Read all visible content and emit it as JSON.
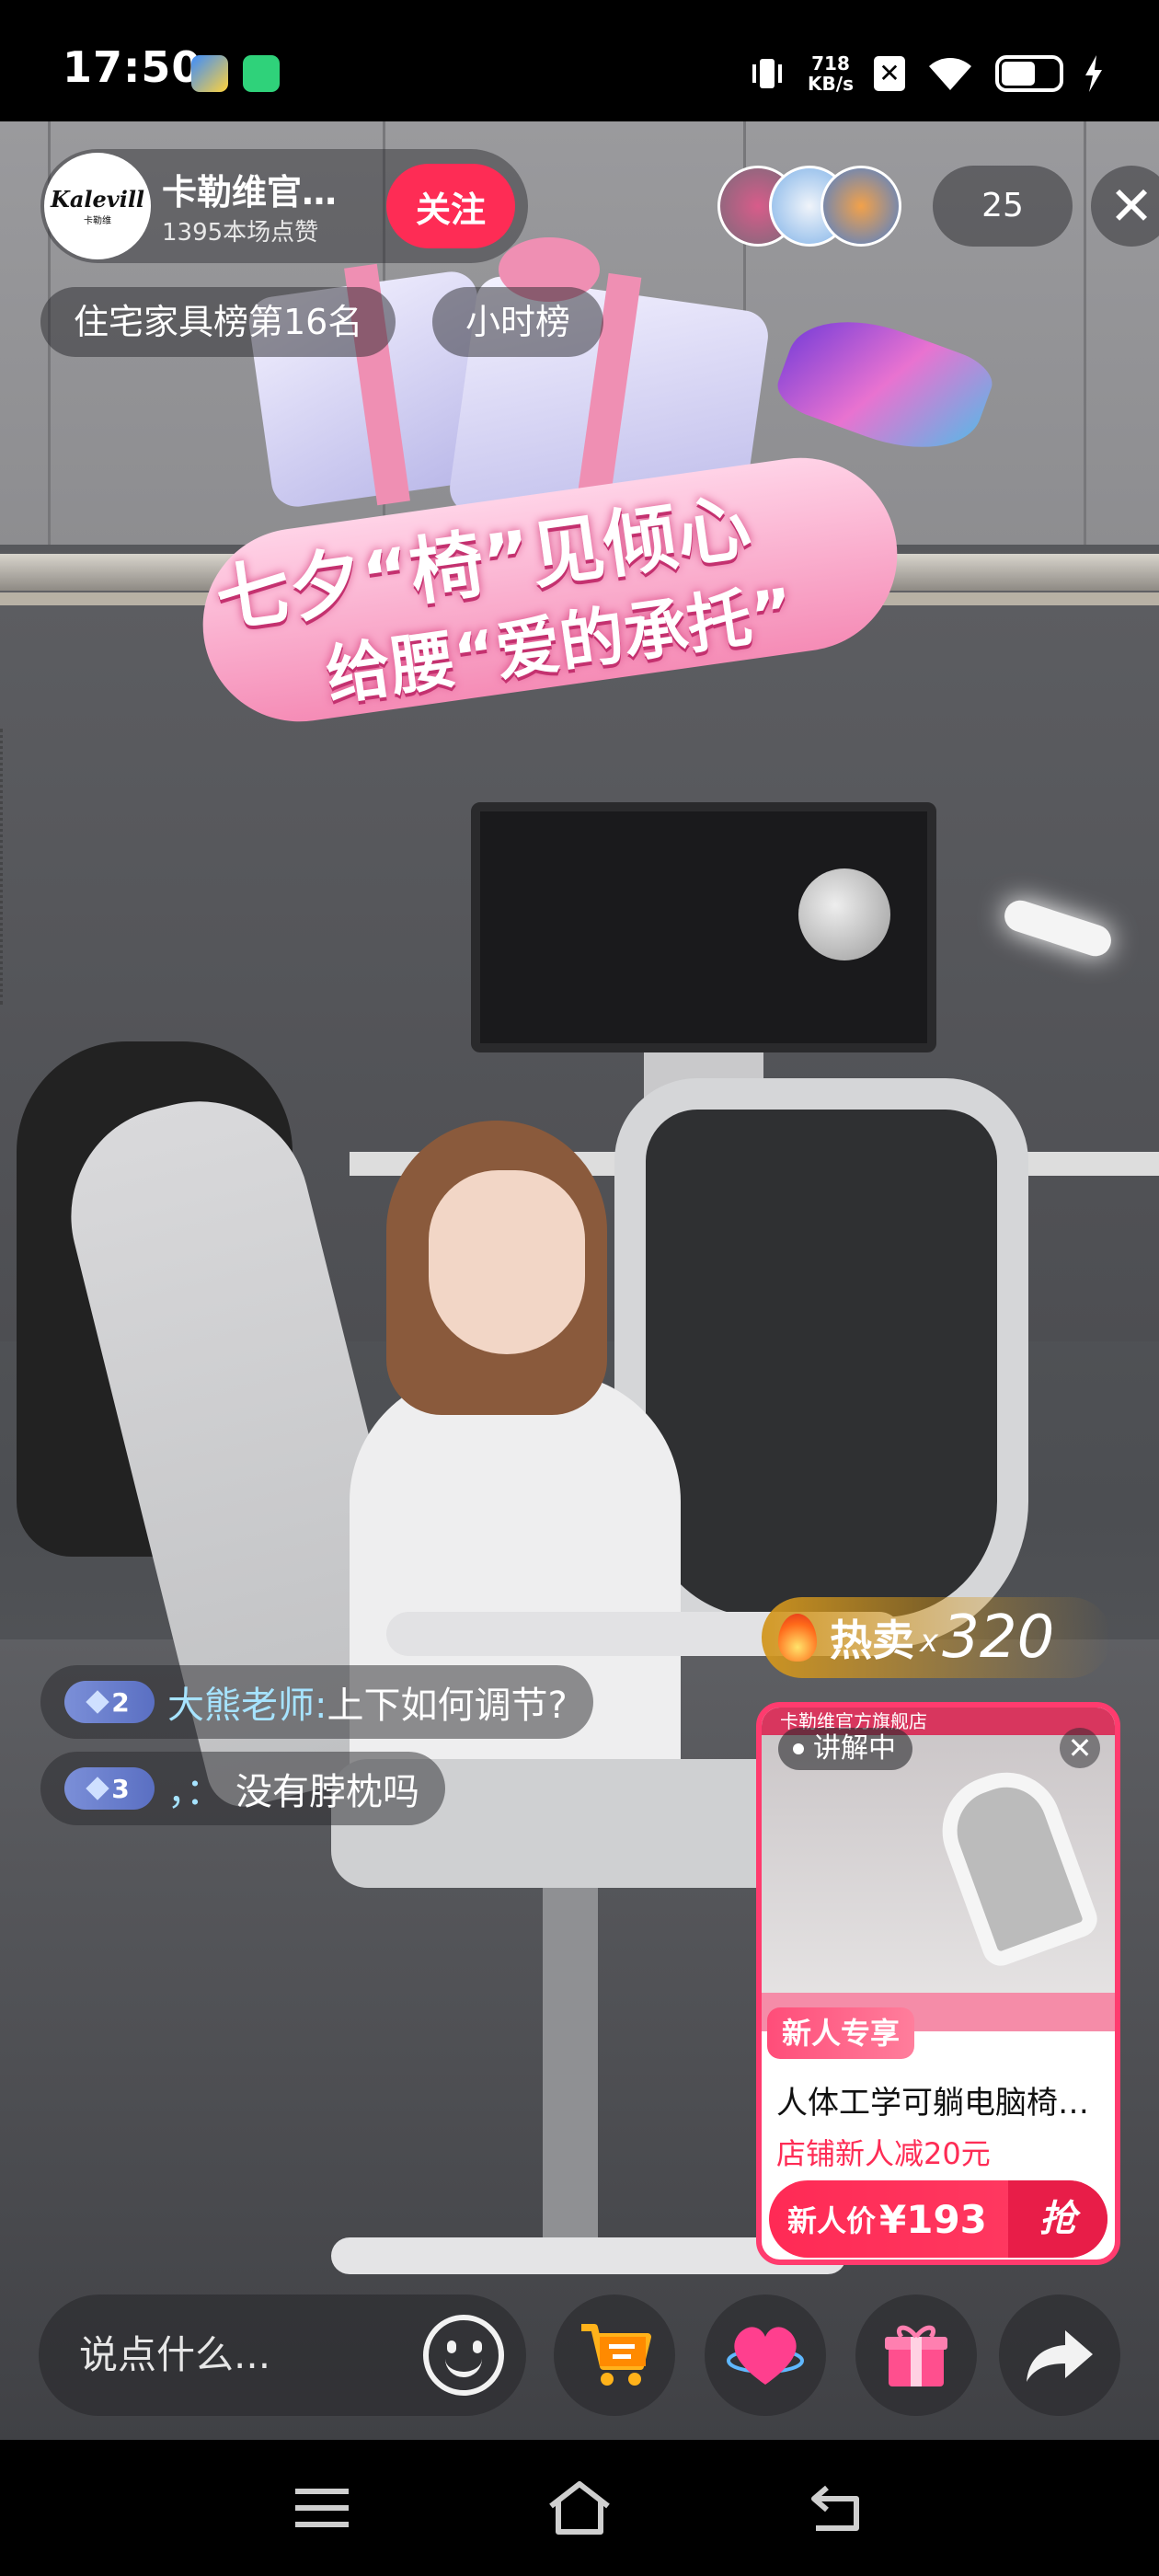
{
  "status_bar": {
    "time": "17:50",
    "net_speed_value": "718",
    "net_speed_unit": "KB/s",
    "battery_level": 0.55
  },
  "host": {
    "avatar_text": "Kalevill",
    "avatar_subtext": "卡勒维",
    "name": "卡勒维官…",
    "likes": "1395本场点赞",
    "follow_label": "关注"
  },
  "audience": {
    "count": "25",
    "close_label": "✕"
  },
  "rank": {
    "rank_label": "住宅家具榜第16名",
    "hourly_label": "小时榜"
  },
  "banner": {
    "line1": "七夕“椅”见倾心",
    "line2": "给腰“爱的承托”"
  },
  "comments": [
    {
      "level": "2",
      "user": "大熊老师:",
      "text": "上下如何调节?"
    },
    {
      "level": "3",
      "user": "，：",
      "text": "没有脖枕吗"
    }
  ],
  "hot_sale": {
    "label": "热卖",
    "x": "x",
    "count": "320"
  },
  "product": {
    "shop_strip": "卡勒维官方旗舰店",
    "explaining_label": "讲解中",
    "close_label": "✕",
    "new_tag": "新人专享",
    "title": "人体工学可躺电脑椅…",
    "promo": "店铺新人减20元",
    "price_label": "新人价",
    "price": "¥193",
    "grab_label": "抢"
  },
  "bottom_bar": {
    "input_placeholder": "说点什么..."
  },
  "colors": {
    "follow": "#fe2c55",
    "price": "#fe2c55",
    "level_badge": "#6b7fd0",
    "comment_user": "#a6e3ff"
  },
  "icons": {
    "emoji": "smile-icon",
    "cart": "shopping-cart-icon",
    "like": "heart-icon",
    "gift": "gift-icon",
    "share": "share-arrow-icon",
    "nav_menu": "menu-icon",
    "nav_home": "home-icon",
    "nav_back": "back-icon"
  }
}
